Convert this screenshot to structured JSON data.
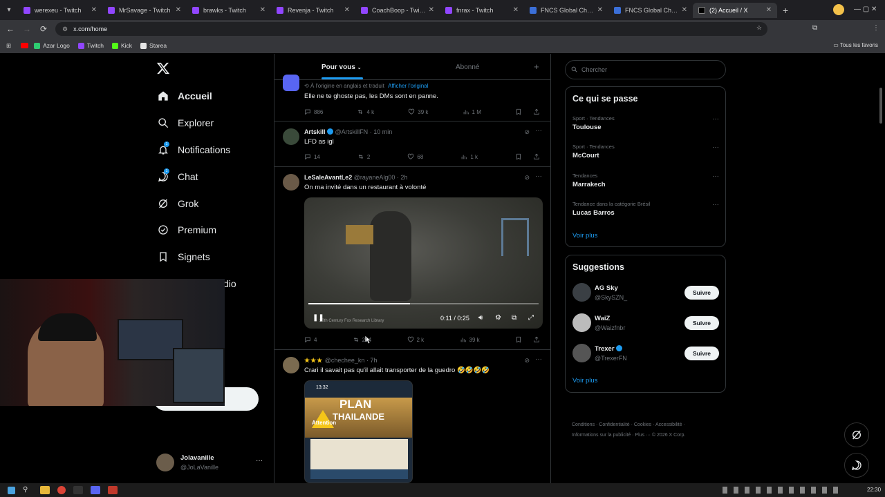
{
  "browser": {
    "tabs": [
      {
        "title": "werexeu - Twitch",
        "kind": "twitch"
      },
      {
        "title": "MrSavage - Twitch",
        "kind": "twitch"
      },
      {
        "title": "brawks - Twitch",
        "kind": "twitch"
      },
      {
        "title": "Revenja - Twitch",
        "kind": "twitch"
      },
      {
        "title": "CoachBoop - Twitch",
        "kind": "twitch"
      },
      {
        "title": "fnrax - Twitch",
        "kind": "twitch"
      },
      {
        "title": "FNCS Global Champ",
        "kind": "fn"
      },
      {
        "title": "FNCS Global Champ",
        "kind": "fn"
      },
      {
        "title": "(2) Accueil / X",
        "kind": "x",
        "active": true
      }
    ],
    "url": "x.com/home",
    "bookmarks": [
      "Azar Logo",
      "Twitch",
      "Kick",
      "Starea"
    ],
    "all_bookmarks": "Tous les favoris"
  },
  "nav": {
    "items": [
      {
        "label": "Accueil",
        "icon": "home-icon",
        "active": true
      },
      {
        "label": "Explorer",
        "icon": "search-icon"
      },
      {
        "label": "Notifications",
        "icon": "bell-icon",
        "badge": "1"
      },
      {
        "label": "Chat",
        "icon": "chat-icon",
        "badge": "1"
      },
      {
        "label": "Grok",
        "icon": "grok-icon"
      },
      {
        "label": "Premium",
        "icon": "premium-icon"
      },
      {
        "label": "Signets",
        "icon": "bookmark-icon"
      },
      {
        "label": "dio",
        "icon": "studio-icon"
      }
    ],
    "account": {
      "name": "Jolavanille",
      "handle": "@JoLaVanille"
    }
  },
  "timeline": {
    "tabs": {
      "for_you": "Pour vous",
      "following": "Abonné"
    },
    "tweets": [
      {
        "translated_note": "À l'origine en anglais et traduit",
        "show_original": "Afficher l'original",
        "text": "Elle ne te ghoste pas, les DMs sont en panne.",
        "replies": "886",
        "reposts": "4 k",
        "likes": "39 k",
        "views": "1 M"
      },
      {
        "name": "Artskill",
        "handle": "@ArtskillFN",
        "time": "· 10 min",
        "text": "LFD as igl",
        "replies": "14",
        "reposts": "2",
        "likes": "68",
        "views": "1 k"
      },
      {
        "name": "LeSaleAvantLe2",
        "handle": "@rayaneAlg00",
        "time": "· 2h",
        "text": "On ma invité dans un restaurant à volonté",
        "video_time": "0:11 / 0:25",
        "video_progress": 0.44,
        "video_credit": "20th Century Fox Research Library",
        "replies": "4",
        "reposts": "214",
        "likes": "2 k",
        "views": "39 k"
      },
      {
        "name": "★★★",
        "handle": "@chechee_kn",
        "time": "· 7h",
        "text": "Crari il savait pas qu'il allait transporter de la guedro 🤣🤣🤣🤣",
        "image_title": "PLAN",
        "image_title2": "THAILANDE",
        "image_time": "13:32",
        "image_sub": "Attention"
      }
    ]
  },
  "right": {
    "search_placeholder": "Chercher",
    "trends_title": "Ce qui se passe",
    "trends": [
      {
        "category": "Sport · Tendances",
        "name": "Toulouse"
      },
      {
        "category": "Sport · Tendances",
        "name": "McCourt"
      },
      {
        "category": "Tendances",
        "name": "Marrakech"
      },
      {
        "category": "Tendance dans la catégorie Brésil",
        "name": "Lucas Barros"
      }
    ],
    "see_more": "Voir plus",
    "suggestions_title": "Suggestions",
    "suggestions": [
      {
        "name": "AG Sky",
        "handle": "@SkySZN_",
        "button": "Suivre"
      },
      {
        "name": "WaiZ",
        "handle": "@Waizfnbr",
        "button": "Suivre"
      },
      {
        "name": "Trexer",
        "handle": "@TrexerFN",
        "button": "Suivre",
        "verified": true
      }
    ],
    "footer1": "Conditions · Confidentialité · Cookies · Accessibilité ·",
    "footer2": "Informations sur la publicité · Plus ··· © 2026 X Corp."
  },
  "taskbar": {
    "time": "22:30"
  },
  "colors": {
    "accent": "#1d9bf0",
    "bg": "#000000",
    "border": "#2f3336",
    "muted": "#71767b"
  }
}
